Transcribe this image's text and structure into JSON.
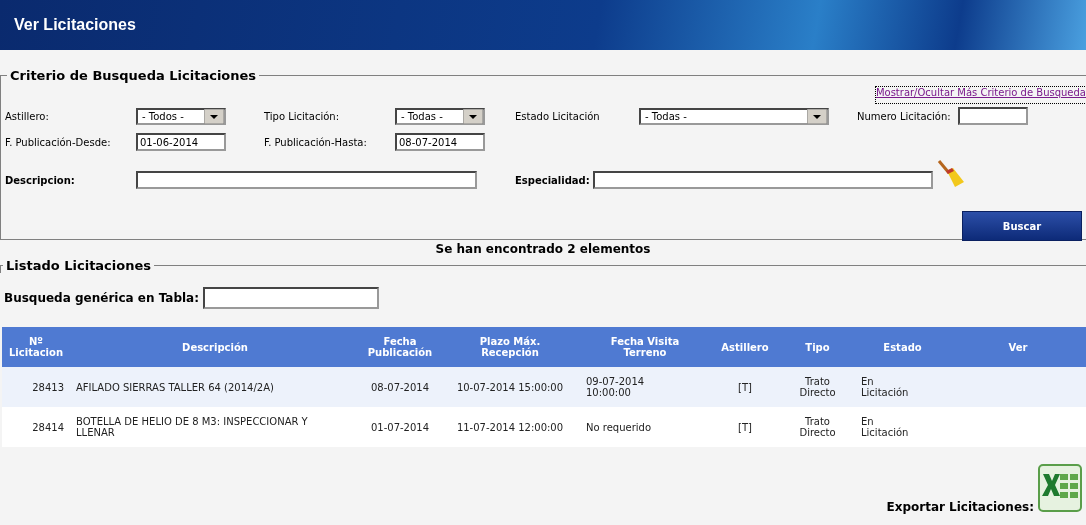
{
  "header": {
    "title": "Ver Licitaciones"
  },
  "search_criteria": {
    "legend": "Criterio de Busqueda Licitaciones",
    "toggle_link": "Mostrar/Ocultar Más Criterio de Busqueda",
    "fields": [
      {
        "kind": "select",
        "label": "Astillero:",
        "value": "- Todos -"
      },
      {
        "kind": "select",
        "label": "Tipo Licitación:",
        "value": "- Todas -"
      },
      {
        "kind": "select",
        "label": "Estado Licitación",
        "value": "- Todas -"
      },
      {
        "kind": "input",
        "label": "Numero Licitación:"
      },
      {
        "kind": "input",
        "label": "F. Publicación-Desde:",
        "value": "01-06-2014"
      },
      {
        "kind": "input",
        "label": "F. Publicación-Hasta:",
        "value": "08-07-2014"
      },
      {
        "kind": "input",
        "label": "Descripcion:"
      },
      {
        "kind": "input",
        "label": "Especialidad:"
      }
    ],
    "search_button": "Buscar"
  },
  "result_count": "Se han encontrado 2 elementos",
  "listing": {
    "legend": "Listado Licitaciones",
    "table_search_label": "Busqueda genérica en Tabla:",
    "columns": [
      "Nº Licitacion",
      "Descripción",
      "Fecha Publicación",
      "Plazo Máx. Recepción",
      "Fecha Visita Terreno",
      "Astillero",
      "Tipo",
      "Estado",
      "Ver"
    ],
    "rows": [
      [
        "28413",
        "AFILADO SIERRAS TALLER 64 (2014/2A)",
        "08-07-2014",
        "10-07-2014 15:00:00",
        "09-07-2014 10:00:00",
        "[T]",
        "Trato Directo",
        "En Licitación"
      ],
      [
        "28414",
        "BOTELLA DE HELIO DE 8 M3: INSPECCIONAR Y LLENAR",
        "01-07-2014",
        "11-07-2014 12:00:00",
        "No requerido",
        "[T]",
        "Trato Directo",
        "En Licitación"
      ]
    ],
    "export_label": "Exportar Licitaciones:"
  }
}
